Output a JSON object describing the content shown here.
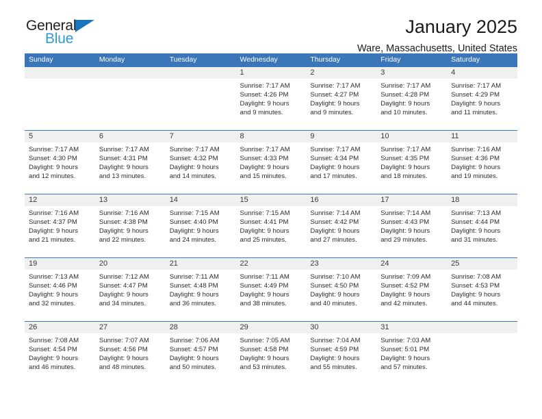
{
  "brand": {
    "name_top": "General",
    "name_bottom": "Blue",
    "triangle_color": "#1B75BB",
    "blue_text_color": "#2E9BD6"
  },
  "header": {
    "title": "January 2025",
    "subtitle": "Ware, Massachusetts, United States"
  },
  "theme": {
    "header_blue": "#3B77B8",
    "daynum_band": "#F0F0F0",
    "text": "#2B2B2B"
  },
  "weekdays": [
    "Sunday",
    "Monday",
    "Tuesday",
    "Wednesday",
    "Thursday",
    "Friday",
    "Saturday"
  ],
  "labels": {
    "sunrise_prefix": "Sunrise:",
    "sunset_prefix": "Sunset:",
    "daylight_prefix": "Daylight:"
  },
  "weeks": [
    [
      {
        "day": "",
        "lines": []
      },
      {
        "day": "",
        "lines": []
      },
      {
        "day": "",
        "lines": []
      },
      {
        "day": "1",
        "lines": [
          "Sunrise: 7:17 AM",
          "Sunset: 4:26 PM",
          "Daylight: 9 hours",
          "and 9 minutes."
        ]
      },
      {
        "day": "2",
        "lines": [
          "Sunrise: 7:17 AM",
          "Sunset: 4:27 PM",
          "Daylight: 9 hours",
          "and 9 minutes."
        ]
      },
      {
        "day": "3",
        "lines": [
          "Sunrise: 7:17 AM",
          "Sunset: 4:28 PM",
          "Daylight: 9 hours",
          "and 10 minutes."
        ]
      },
      {
        "day": "4",
        "lines": [
          "Sunrise: 7:17 AM",
          "Sunset: 4:29 PM",
          "Daylight: 9 hours",
          "and 11 minutes."
        ]
      }
    ],
    [
      {
        "day": "5",
        "lines": [
          "Sunrise: 7:17 AM",
          "Sunset: 4:30 PM",
          "Daylight: 9 hours",
          "and 12 minutes."
        ]
      },
      {
        "day": "6",
        "lines": [
          "Sunrise: 7:17 AM",
          "Sunset: 4:31 PM",
          "Daylight: 9 hours",
          "and 13 minutes."
        ]
      },
      {
        "day": "7",
        "lines": [
          "Sunrise: 7:17 AM",
          "Sunset: 4:32 PM",
          "Daylight: 9 hours",
          "and 14 minutes."
        ]
      },
      {
        "day": "8",
        "lines": [
          "Sunrise: 7:17 AM",
          "Sunset: 4:33 PM",
          "Daylight: 9 hours",
          "and 15 minutes."
        ]
      },
      {
        "day": "9",
        "lines": [
          "Sunrise: 7:17 AM",
          "Sunset: 4:34 PM",
          "Daylight: 9 hours",
          "and 17 minutes."
        ]
      },
      {
        "day": "10",
        "lines": [
          "Sunrise: 7:17 AM",
          "Sunset: 4:35 PM",
          "Daylight: 9 hours",
          "and 18 minutes."
        ]
      },
      {
        "day": "11",
        "lines": [
          "Sunrise: 7:16 AM",
          "Sunset: 4:36 PM",
          "Daylight: 9 hours",
          "and 19 minutes."
        ]
      }
    ],
    [
      {
        "day": "12",
        "lines": [
          "Sunrise: 7:16 AM",
          "Sunset: 4:37 PM",
          "Daylight: 9 hours",
          "and 21 minutes."
        ]
      },
      {
        "day": "13",
        "lines": [
          "Sunrise: 7:16 AM",
          "Sunset: 4:38 PM",
          "Daylight: 9 hours",
          "and 22 minutes."
        ]
      },
      {
        "day": "14",
        "lines": [
          "Sunrise: 7:15 AM",
          "Sunset: 4:40 PM",
          "Daylight: 9 hours",
          "and 24 minutes."
        ]
      },
      {
        "day": "15",
        "lines": [
          "Sunrise: 7:15 AM",
          "Sunset: 4:41 PM",
          "Daylight: 9 hours",
          "and 25 minutes."
        ]
      },
      {
        "day": "16",
        "lines": [
          "Sunrise: 7:14 AM",
          "Sunset: 4:42 PM",
          "Daylight: 9 hours",
          "and 27 minutes."
        ]
      },
      {
        "day": "17",
        "lines": [
          "Sunrise: 7:14 AM",
          "Sunset: 4:43 PM",
          "Daylight: 9 hours",
          "and 29 minutes."
        ]
      },
      {
        "day": "18",
        "lines": [
          "Sunrise: 7:13 AM",
          "Sunset: 4:44 PM",
          "Daylight: 9 hours",
          "and 31 minutes."
        ]
      }
    ],
    [
      {
        "day": "19",
        "lines": [
          "Sunrise: 7:13 AM",
          "Sunset: 4:46 PM",
          "Daylight: 9 hours",
          "and 32 minutes."
        ]
      },
      {
        "day": "20",
        "lines": [
          "Sunrise: 7:12 AM",
          "Sunset: 4:47 PM",
          "Daylight: 9 hours",
          "and 34 minutes."
        ]
      },
      {
        "day": "21",
        "lines": [
          "Sunrise: 7:11 AM",
          "Sunset: 4:48 PM",
          "Daylight: 9 hours",
          "and 36 minutes."
        ]
      },
      {
        "day": "22",
        "lines": [
          "Sunrise: 7:11 AM",
          "Sunset: 4:49 PM",
          "Daylight: 9 hours",
          "and 38 minutes."
        ]
      },
      {
        "day": "23",
        "lines": [
          "Sunrise: 7:10 AM",
          "Sunset: 4:50 PM",
          "Daylight: 9 hours",
          "and 40 minutes."
        ]
      },
      {
        "day": "24",
        "lines": [
          "Sunrise: 7:09 AM",
          "Sunset: 4:52 PM",
          "Daylight: 9 hours",
          "and 42 minutes."
        ]
      },
      {
        "day": "25",
        "lines": [
          "Sunrise: 7:08 AM",
          "Sunset: 4:53 PM",
          "Daylight: 9 hours",
          "and 44 minutes."
        ]
      }
    ],
    [
      {
        "day": "26",
        "lines": [
          "Sunrise: 7:08 AM",
          "Sunset: 4:54 PM",
          "Daylight: 9 hours",
          "and 46 minutes."
        ]
      },
      {
        "day": "27",
        "lines": [
          "Sunrise: 7:07 AM",
          "Sunset: 4:56 PM",
          "Daylight: 9 hours",
          "and 48 minutes."
        ]
      },
      {
        "day": "28",
        "lines": [
          "Sunrise: 7:06 AM",
          "Sunset: 4:57 PM",
          "Daylight: 9 hours",
          "and 50 minutes."
        ]
      },
      {
        "day": "29",
        "lines": [
          "Sunrise: 7:05 AM",
          "Sunset: 4:58 PM",
          "Daylight: 9 hours",
          "and 53 minutes."
        ]
      },
      {
        "day": "30",
        "lines": [
          "Sunrise: 7:04 AM",
          "Sunset: 4:59 PM",
          "Daylight: 9 hours",
          "and 55 minutes."
        ]
      },
      {
        "day": "31",
        "lines": [
          "Sunrise: 7:03 AM",
          "Sunset: 5:01 PM",
          "Daylight: 9 hours",
          "and 57 minutes."
        ]
      },
      {
        "day": "",
        "lines": []
      }
    ]
  ]
}
